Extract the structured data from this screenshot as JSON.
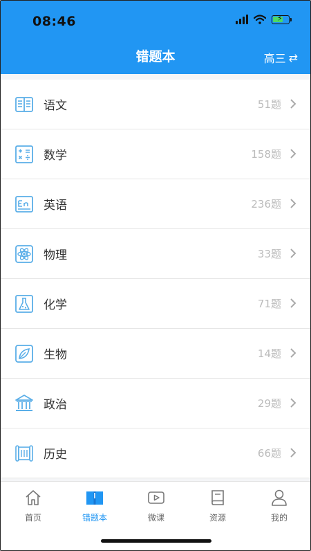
{
  "status_bar": {
    "time": "08:46"
  },
  "header": {
    "title": "错题本",
    "grade": "高三",
    "switch_glyph": "⇄"
  },
  "subjects": [
    {
      "name": "语文",
      "count": "51题",
      "icon": "book-columns-icon"
    },
    {
      "name": "数学",
      "count": "158题",
      "icon": "math-operators-icon"
    },
    {
      "name": "英语",
      "count": "236题",
      "icon": "en-letters-icon"
    },
    {
      "name": "物理",
      "count": "33题",
      "icon": "atom-icon"
    },
    {
      "name": "化学",
      "count": "71题",
      "icon": "flask-icon"
    },
    {
      "name": "生物",
      "count": "14题",
      "icon": "leaf-icon"
    },
    {
      "name": "政治",
      "count": "29题",
      "icon": "building-icon"
    },
    {
      "name": "历史",
      "count": "66题",
      "icon": "scroll-icon"
    }
  ],
  "tabs": [
    {
      "label": "首页",
      "icon": "home-icon"
    },
    {
      "label": "错题本",
      "icon": "open-book-icon",
      "active": true
    },
    {
      "label": "微课",
      "icon": "video-play-icon"
    },
    {
      "label": "资源",
      "icon": "resource-book-icon"
    },
    {
      "label": "我的",
      "icon": "person-icon"
    }
  ],
  "colors": {
    "accent": "#2196f3",
    "icon_blue": "#5aaee8",
    "muted_text": "#bbbbbb"
  }
}
